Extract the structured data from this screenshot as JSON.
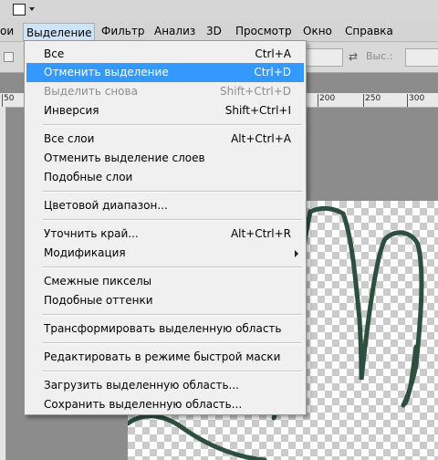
{
  "menubar": {
    "items": [
      {
        "label": "ои"
      },
      {
        "label": "Выделение"
      },
      {
        "label": "Фильтр"
      },
      {
        "label": "Анализ"
      },
      {
        "label": "3D"
      },
      {
        "label": "Просмотр"
      },
      {
        "label": "Окно"
      },
      {
        "label": "Справка"
      }
    ]
  },
  "options": {
    "height_label": "Выс.:",
    "swap_icon": "swap-arrows-icon"
  },
  "ruler": {
    "ticks": [
      "50",
      "200",
      "250",
      "300"
    ]
  },
  "menu": {
    "items": [
      {
        "label": "Все",
        "shortcut": "Ctrl+A"
      },
      {
        "label": "Отменить выделение",
        "shortcut": "Ctrl+D",
        "highlighted": true
      },
      {
        "label": "Выделить снова",
        "shortcut": "Shift+Ctrl+D",
        "disabled": true
      },
      {
        "label": "Инверсия",
        "shortcut": "Shift+Ctrl+I"
      },
      {
        "label": "Все слои",
        "shortcut": "Alt+Ctrl+A"
      },
      {
        "label": "Отменить выделение слоев",
        "shortcut": ""
      },
      {
        "label": "Подобные слои",
        "shortcut": ""
      },
      {
        "label": "Цветовой диапазон...",
        "shortcut": ""
      },
      {
        "label": "Уточнить край...",
        "shortcut": "Alt+Ctrl+R"
      },
      {
        "label": "Модификация",
        "shortcut": "",
        "submenu": true
      },
      {
        "label": "Смежные пикселы",
        "shortcut": ""
      },
      {
        "label": "Подобные оттенки",
        "shortcut": ""
      },
      {
        "label": "Трансформировать выделенную область",
        "shortcut": ""
      },
      {
        "label": "Редактировать в режиме быстрой маски",
        "shortcut": ""
      },
      {
        "label": "Загрузить выделенную область...",
        "shortcut": ""
      },
      {
        "label": "Сохранить выделенную область...",
        "shortcut": ""
      }
    ]
  },
  "colors": {
    "highlight": "#3399ff",
    "outline": "#2c4f3e",
    "disabled": "#8d8d8d"
  }
}
